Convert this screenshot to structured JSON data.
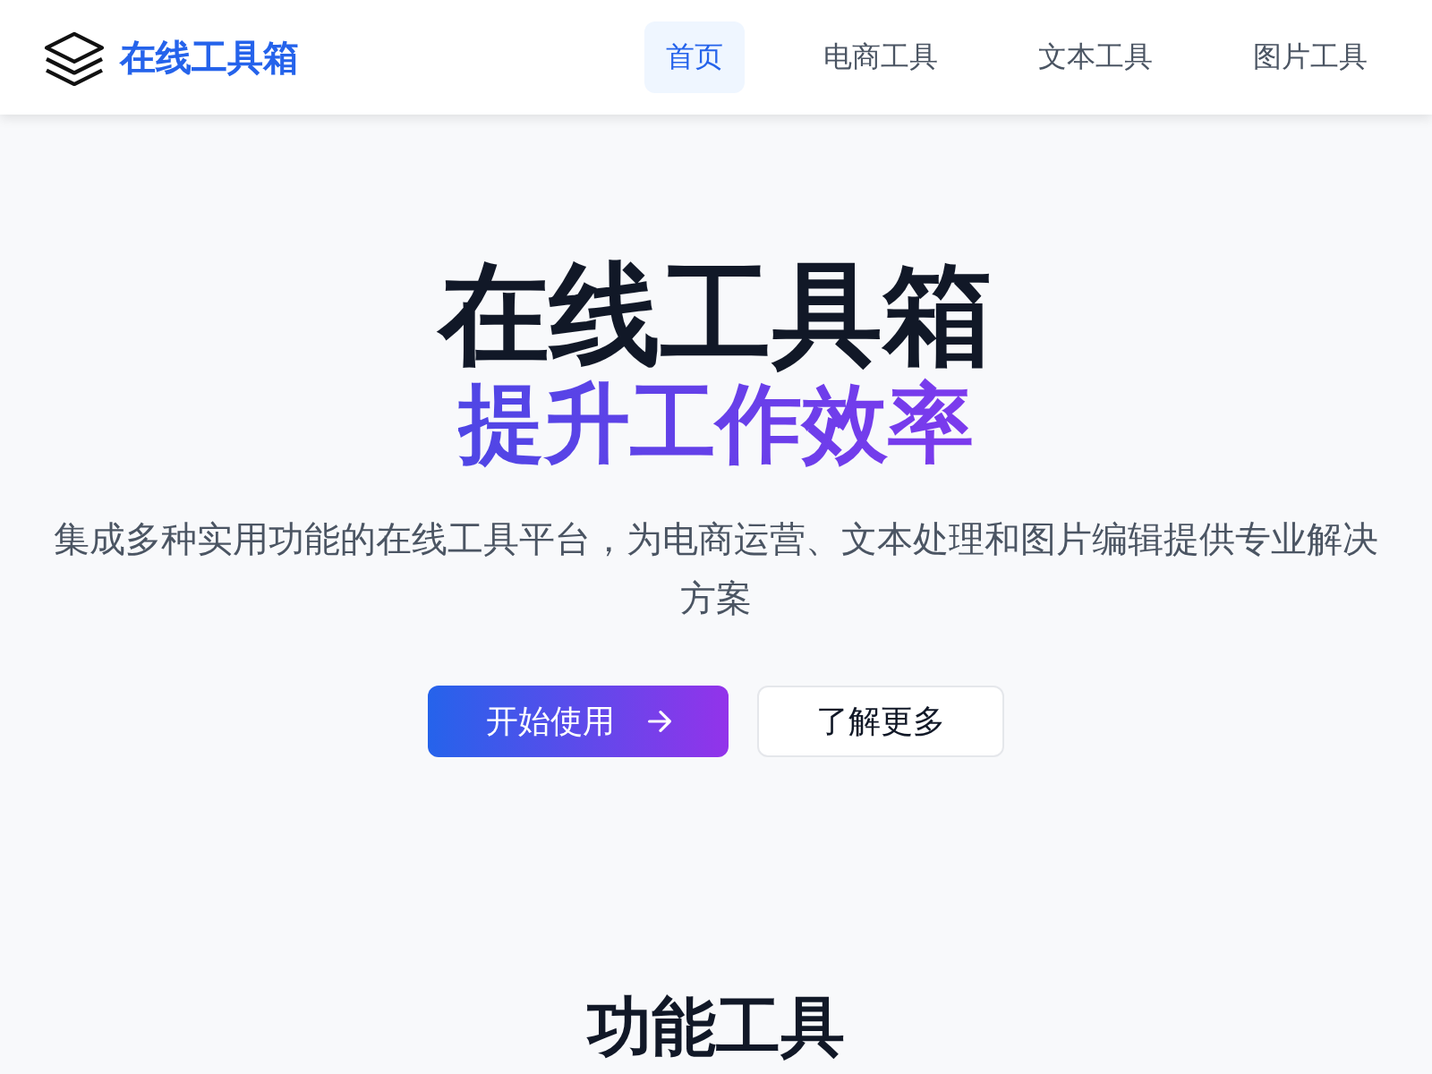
{
  "header": {
    "logo_text": "在线工具箱",
    "nav": [
      {
        "label": "首页",
        "selected": true
      },
      {
        "label": "电商工具",
        "selected": false
      },
      {
        "label": "文本工具",
        "selected": false
      },
      {
        "label": "图片工具",
        "selected": false
      }
    ]
  },
  "hero": {
    "title": "在线工具箱",
    "subtitle": "提升工作效率",
    "description": "集成多种实用功能的在线工具平台，为电商运营、文本处理和图片编辑提供专业解决方案",
    "buttons": [
      {
        "label": "开始使用",
        "kind": "primary"
      },
      {
        "label": "了解更多",
        "kind": "secondary"
      }
    ]
  },
  "features": {
    "title": "功能工具"
  }
}
